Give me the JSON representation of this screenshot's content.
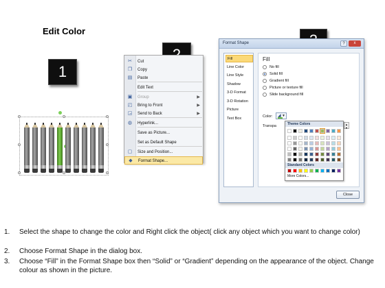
{
  "title": "Edit Color",
  "steps": {
    "one": "1",
    "two": "2",
    "three": "3"
  },
  "context_menu": {
    "items": [
      {
        "label": "Cut",
        "icon": "scissors-icon",
        "disabled": false,
        "submenu": false
      },
      {
        "label": "Copy",
        "icon": "copy-icon",
        "disabled": false,
        "submenu": false
      },
      {
        "label": "Paste",
        "icon": "paste-icon",
        "disabled": false,
        "submenu": false
      },
      {
        "label": "Edit Text",
        "icon": "",
        "disabled": false,
        "submenu": false
      },
      {
        "label": "Group",
        "icon": "group-icon",
        "disabled": true,
        "submenu": true
      },
      {
        "label": "Bring to Front",
        "icon": "bring-front-icon",
        "disabled": false,
        "submenu": true
      },
      {
        "label": "Send to Back",
        "icon": "send-back-icon",
        "disabled": false,
        "submenu": true
      },
      {
        "label": "Hyperlink...",
        "icon": "globe-link-icon",
        "disabled": false,
        "submenu": false
      },
      {
        "label": "Save as Picture...",
        "icon": "",
        "disabled": false,
        "submenu": false
      },
      {
        "label": "Set as Default Shape",
        "icon": "",
        "disabled": false,
        "submenu": false
      },
      {
        "label": "Size and Position...",
        "icon": "size-icon",
        "disabled": false,
        "submenu": false
      },
      {
        "label": "Format Shape...",
        "icon": "format-shape-icon",
        "disabled": false,
        "submenu": false,
        "highlighted": true
      }
    ]
  },
  "dialog": {
    "title": "Format Shape",
    "help": "?",
    "close_x": "x",
    "nav": [
      "Fill",
      "Line Color",
      "Line Style",
      "Shadow",
      "3-D Format",
      "3-D Rotation",
      "Picture",
      "Text Box"
    ],
    "nav_active": "Fill",
    "panel_heading": "Fill",
    "fill_options": [
      "No fill",
      "Solid fill",
      "Gradient fill",
      "Picture or texture fill",
      "Slide background fill"
    ],
    "fill_selected": "Solid fill",
    "color_label": "Color:",
    "transparency_label": "Transpa",
    "theme_colors_label": "Theme Colors",
    "standard_colors_label": "Standard Colors",
    "more_colors_label": "More Colors...",
    "close_button": "Close",
    "theme_top_row": [
      "#ffffff",
      "#000000",
      "#eeece1",
      "#1f497d",
      "#4f81bd",
      "#c0504d",
      "#9bbb59",
      "#8064a2",
      "#4bacc6",
      "#f79646"
    ],
    "standard_colors": [
      "#c00000",
      "#ff0000",
      "#ffc000",
      "#ffff00",
      "#92d050",
      "#00b050",
      "#00b0f0",
      "#0070c0",
      "#002060",
      "#7030a0"
    ]
  },
  "instructions": [
    {
      "num": "1.",
      "text": "Select the shape to change the color and Right click the object( click any object which you want to change color)"
    },
    {
      "num": "2.",
      "text": "Choose Format Shape in the dialog box."
    },
    {
      "num": "3.",
      "text": "Choose “Fill” in the Format Shape box then “Solid” or “Gradient” depending on the appearance of the object. Change colour as shown in the picture."
    }
  ],
  "pencils": {
    "count": 10,
    "highlighted_index": 4,
    "highlight_color": "#6abf3e"
  }
}
